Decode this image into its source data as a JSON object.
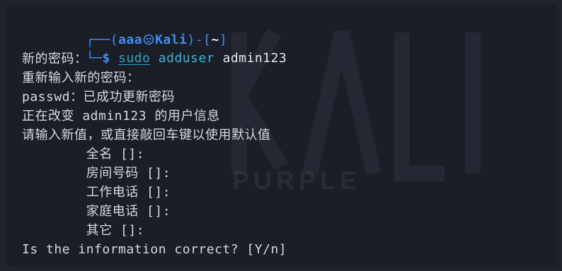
{
  "prompt": {
    "top_left": "┌──(",
    "user": "aaa",
    "host": "Kali",
    "mid": ")-[",
    "dir": "~",
    "end": "]",
    "bottom_left": "└─",
    "dollar": "$",
    "sudo": "sudo",
    "command": "adduser",
    "args": "admin123"
  },
  "output": [
    "新的密码：",
    "重新输入新的密码：",
    "passwd：已成功更新密码",
    "正在改变 admin123 的用户信息",
    "请输入新值，或直接敲回车键以使用默认值",
    "        全名 []:",
    "        房间号码 []:",
    "        工作电话 []:",
    "        家庭电话 []:",
    "        其它 []:",
    "Is the information correct? [Y/n]"
  ],
  "watermark": {
    "word": "PURPLE",
    "logo_text": "KALI"
  },
  "colors": {
    "background": "#1b1e26",
    "prompt_blue": "#3e8ef7",
    "command_cyan": "#39b4d6",
    "text": "#d7d9de"
  },
  "icons": {
    "host_separator": "kali-skull-icon"
  }
}
